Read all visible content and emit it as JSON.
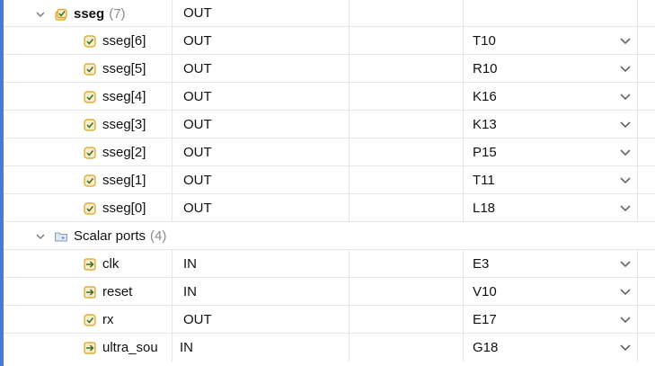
{
  "columns": {
    "dir_header_blank": "",
    "site_header_blank": ""
  },
  "groups": [
    {
      "name": "sseg",
      "count": "(7)",
      "direction": "OUT",
      "icon": "bus-output-icon",
      "rows": [
        {
          "name": "sseg[6]",
          "direction": "OUT",
          "site": "T10",
          "icon": "output-port-icon"
        },
        {
          "name": "sseg[5]",
          "direction": "OUT",
          "site": "R10",
          "icon": "output-port-icon"
        },
        {
          "name": "sseg[4]",
          "direction": "OUT",
          "site": "K16",
          "icon": "output-port-icon"
        },
        {
          "name": "sseg[3]",
          "direction": "OUT",
          "site": "K13",
          "icon": "output-port-icon"
        },
        {
          "name": "sseg[2]",
          "direction": "OUT",
          "site": "P15",
          "icon": "output-port-icon"
        },
        {
          "name": "sseg[1]",
          "direction": "OUT",
          "site": "T11",
          "icon": "output-port-icon"
        },
        {
          "name": "sseg[0]",
          "direction": "OUT",
          "site": "L18",
          "icon": "output-port-icon"
        }
      ]
    },
    {
      "name": "Scalar ports",
      "count": "(4)",
      "direction": "",
      "icon": "folder-icon",
      "rows": [
        {
          "name": "clk",
          "direction": "IN",
          "site": "E3",
          "icon": "input-port-icon"
        },
        {
          "name": "reset",
          "direction": "IN",
          "site": "V10",
          "icon": "input-port-icon"
        },
        {
          "name": "rx",
          "direction": "OUT",
          "site": "E17",
          "icon": "output-port-icon"
        },
        {
          "name": "ultra_sou",
          "direction": "IN",
          "site": "G18",
          "icon": "input-port-icon"
        }
      ]
    }
  ],
  "colors": {
    "accent": "#4a7bd0",
    "port_icon": "#d8a21c",
    "grid_line": "#e6e6e6"
  }
}
